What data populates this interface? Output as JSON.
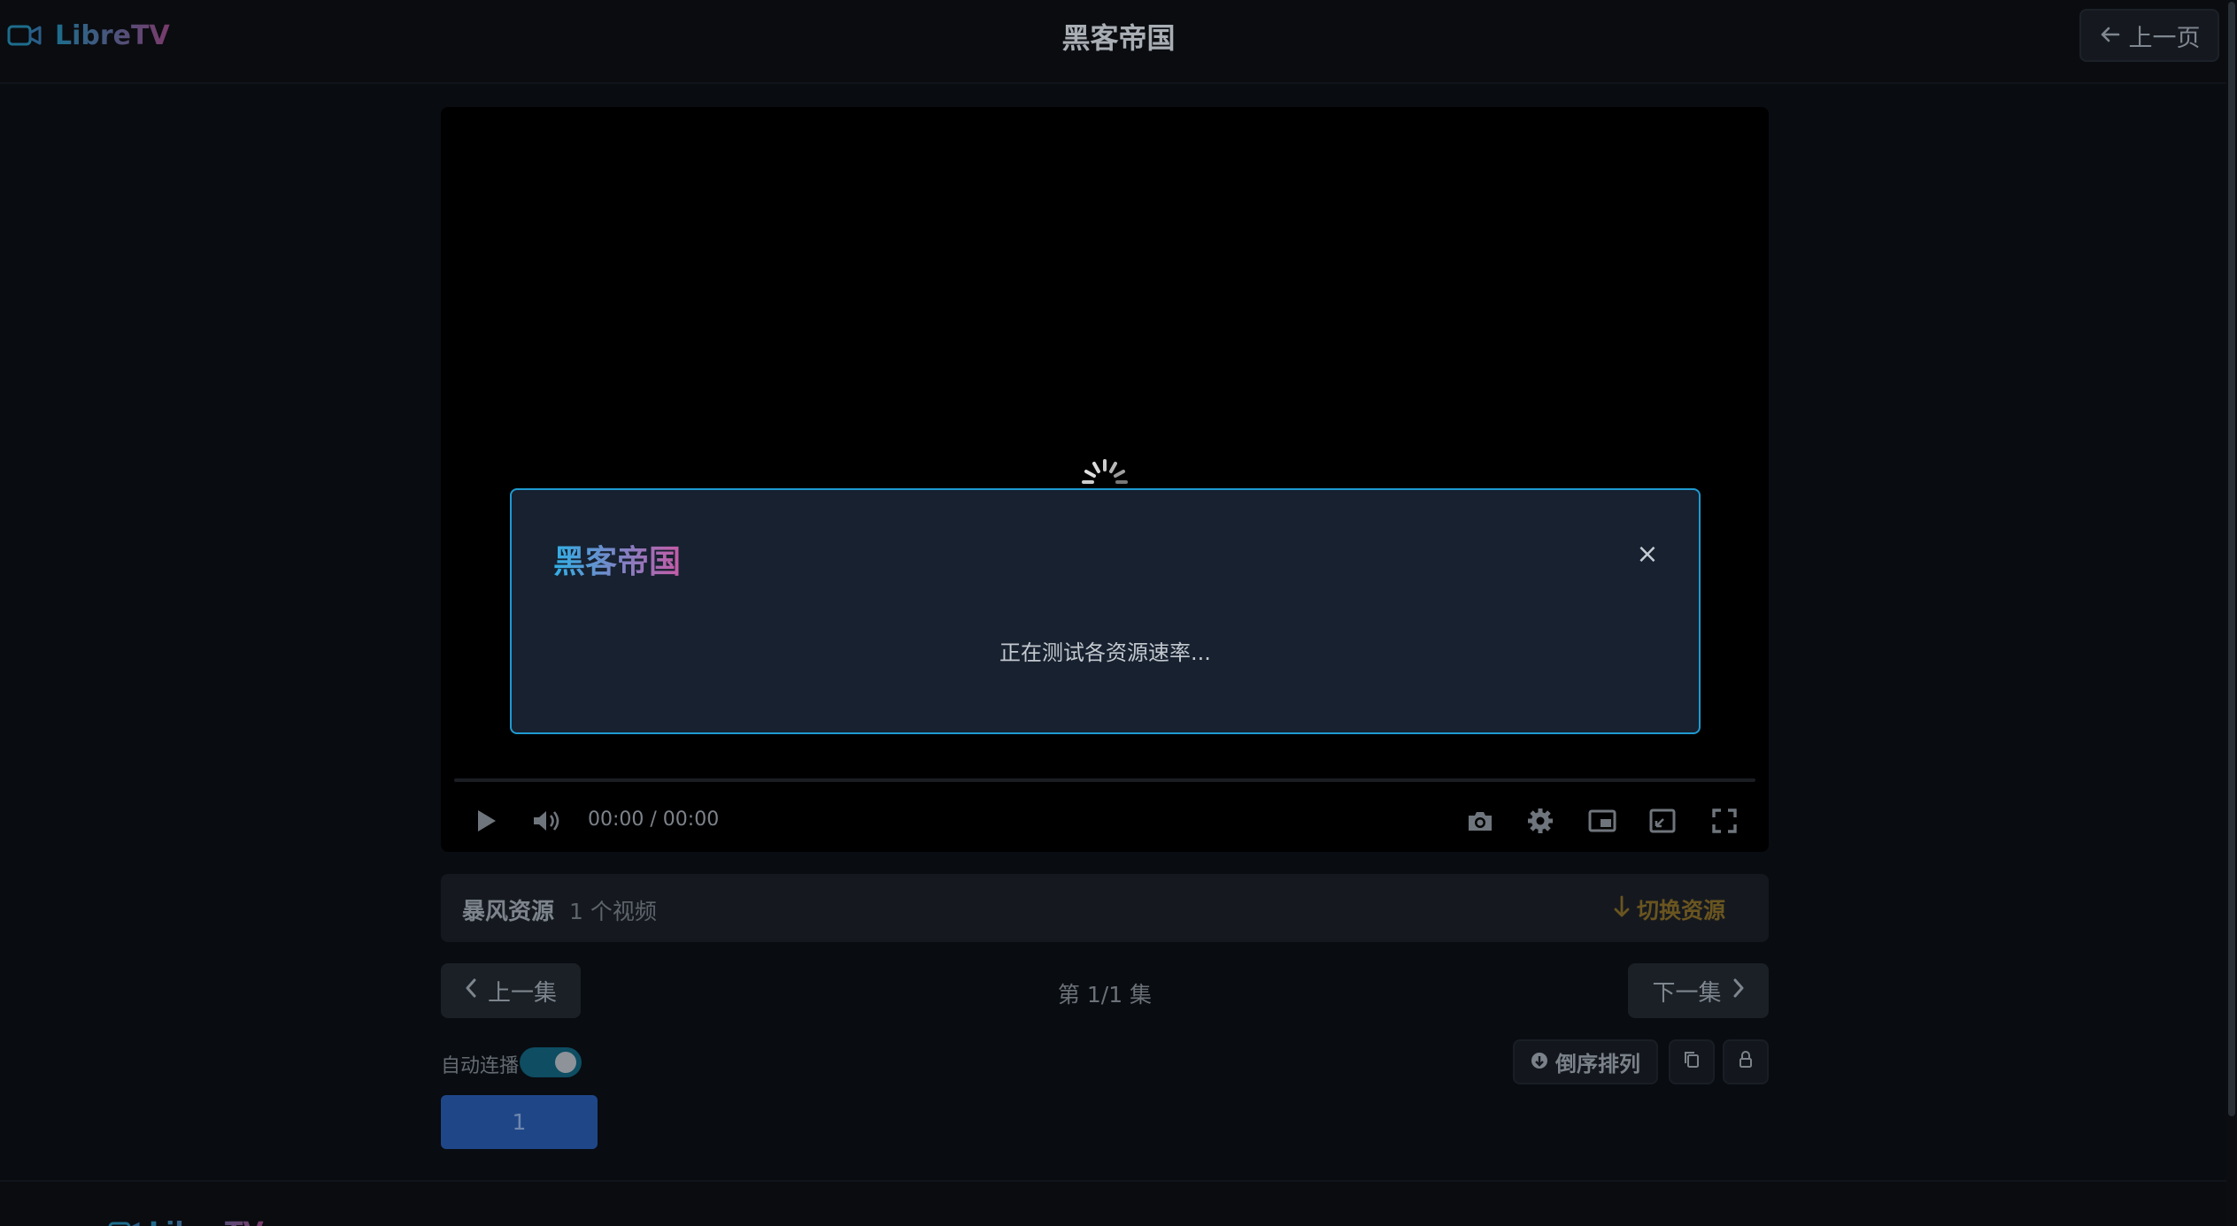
{
  "app": {
    "name": "LibreTV",
    "title": "黑客帝国",
    "back_label": "上一页"
  },
  "player": {
    "time": "00:00 / 00:00",
    "progress": 0
  },
  "modal": {
    "title": "黑客帝国",
    "close_glyph": "×",
    "message": "正在测试各资源速率..."
  },
  "source": {
    "name": "暴风资源",
    "count": "1 个视频",
    "switch_label": "切换资源"
  },
  "episodes": {
    "prev_label": "上一集",
    "next_label": "下一集",
    "indicator": "第 1/1 集",
    "autoplay_label": "自动连播",
    "autoplay_on": true,
    "sort_label": "倒序排列",
    "items": [
      "1"
    ]
  },
  "colors": {
    "accent": "#1f9bd1",
    "modal_bg": "#172130",
    "episode_btn": "#1f4788",
    "switch_text": "#6a5520"
  }
}
